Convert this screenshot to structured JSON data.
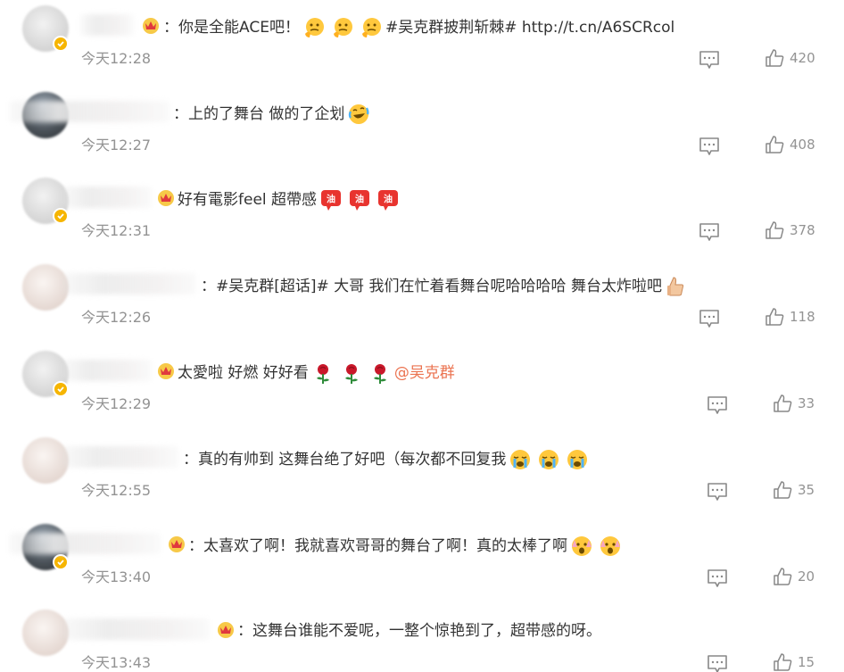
{
  "comments": [
    {
      "pre": "：你是全能ACE吧！",
      "emojis": [
        "thinking",
        "thinking",
        "thinking"
      ],
      "post": "#吴克群披荆斩棘# http://t.cn/A6SCRcol",
      "mention": "",
      "time": "今天12:28",
      "likes": "420",
      "vip": true,
      "verified": true
    },
    {
      "pre": "：上的了舞台 做的了企划",
      "emojis": [
        "laugh-cry"
      ],
      "post": "",
      "mention": "",
      "time": "今天12:27",
      "likes": "408",
      "vip": false,
      "verified": false
    },
    {
      "pre": "好有電影feel 超帶感",
      "emojis": [
        "jiayou",
        "jiayou",
        "jiayou"
      ],
      "post": "",
      "mention": "",
      "time": "今天12:31",
      "likes": "378",
      "vip": true,
      "verified": true
    },
    {
      "pre": "：#吴克群[超话]# 大哥 我们在忙着看舞台呢哈哈哈哈 舞台太炸啦吧",
      "emojis": [
        "thumbs-up"
      ],
      "post": "",
      "mention": "",
      "time": "今天12:26",
      "likes": "118",
      "vip": false,
      "verified": false
    },
    {
      "pre": "太愛啦 好燃 好好看",
      "emojis": [
        "rose",
        "rose",
        "rose"
      ],
      "post": "",
      "mention": "@吴克群",
      "time": "今天12:29",
      "likes": "33",
      "vip": true,
      "verified": true
    },
    {
      "pre": "：真的有帅到 这舞台绝了好吧（每次都不回复我",
      "emojis": [
        "crying",
        "crying",
        "crying"
      ],
      "post": "",
      "mention": "",
      "time": "今天12:55",
      "likes": "35",
      "vip": false,
      "verified": false
    },
    {
      "pre": "：太喜欢了啊！我就喜欢哥哥的舞台了啊！真的太棒了啊",
      "emojis": [
        "shocked",
        "shocked"
      ],
      "post": "",
      "mention": "",
      "time": "今天13:40",
      "likes": "20",
      "vip": true,
      "verified": true
    },
    {
      "pre": "：这舞台谁能不爱呢，一整个惊艳到了，超带感的呀。",
      "emojis": [],
      "post": "",
      "mention": "",
      "time": "今天13:43",
      "likes": "15",
      "vip": true,
      "verified": false
    }
  ],
  "colors": {
    "mention": "#eb7350",
    "time": "#939393",
    "text": "#333333",
    "verified": "#f6b500"
  }
}
